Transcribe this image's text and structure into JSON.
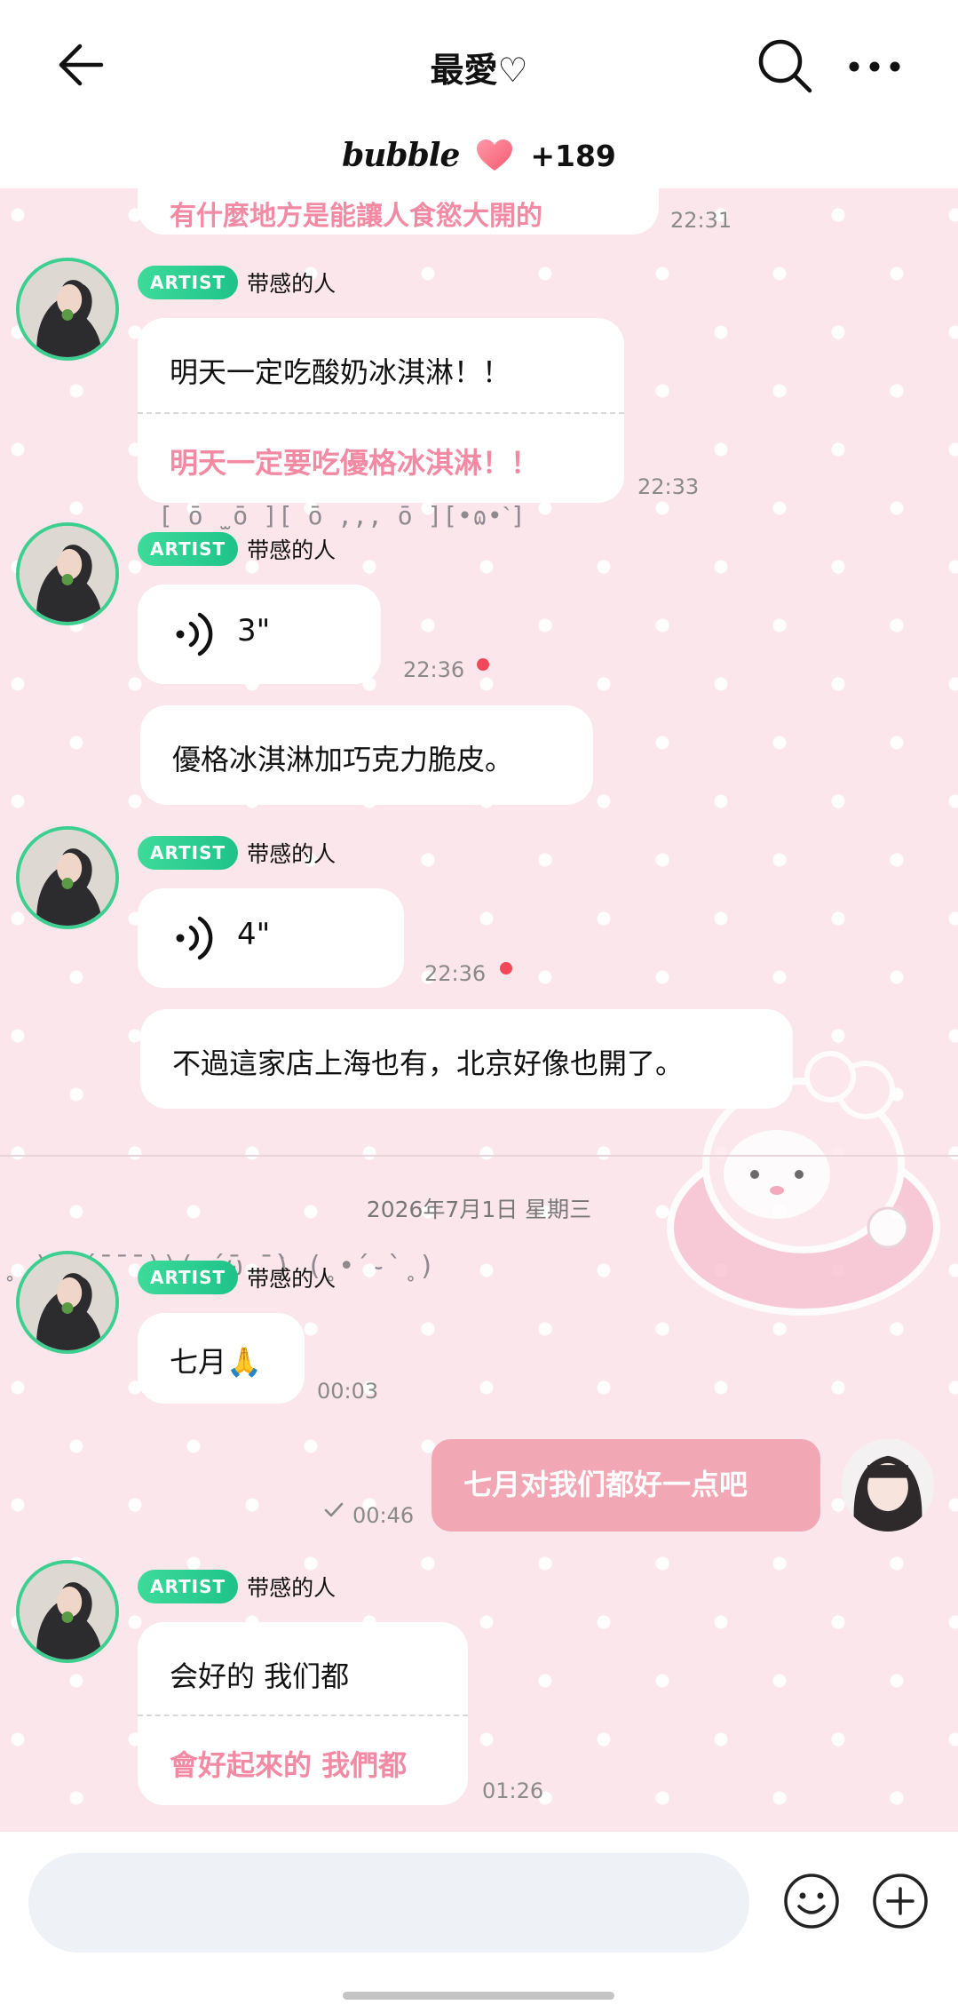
{
  "header": {
    "title": "最愛♡",
    "brand": "bubble",
    "count": "+189",
    "back_icon": "arrow-left-icon",
    "search_icon": "search-icon",
    "more_icon": "more-horizontal-icon"
  },
  "colors": {
    "chat_background": "#fbe6ec",
    "artist_badge": "#2bd392",
    "translation_text": "#f28aa4",
    "my_bubble": "#f2a8b4",
    "unread_dot": "#f04a5a"
  },
  "messages": {
    "m0": {
      "text_partial": "有什麼地方是能讓人食慾大開的",
      "time": "22:31"
    },
    "m1": {
      "badge": "ARTIST",
      "sender": "带感的人",
      "text": "明天一定吃酸奶冰淇淋！！",
      "translation": "明天一定要吃優格冰淇淋！！",
      "time": "22:33"
    },
    "kaomoji1": "[ ō ̫ ō ][ ō ,,, ō ][•ɷ•ˋ]",
    "m2": {
      "badge": "ARTIST",
      "sender": "带感的人",
      "voice_duration": "3\"",
      "time": "22:36"
    },
    "m3": {
      "text": "優格冰淇淋加巧克力脆皮。"
    },
    "m4": {
      "badge": "ARTIST",
      "sender": "带感的人",
      "voice_duration": "4\"",
      "time": "22:36"
    },
    "m5": {
      "text": "不過這家店上海也有，北京好像也開了。"
    },
    "date_separator": "2026年7月1日 星期三",
    "kaomoji2": "˳ )( ́ ̄ ̄ ̄ ))( ́ ̄ω ̄ ̀) (˳•́ ֊̀ ˳)",
    "m6": {
      "badge": "ARTIST",
      "sender": "带感的人",
      "text": "七月🙏",
      "time": "00:03"
    },
    "m7": {
      "text": "七月对我们都好一点吧",
      "time": "00:46",
      "status_icon": "check-icon"
    },
    "m8": {
      "badge": "ARTIST",
      "sender": "带感的人",
      "text": "会好的 我们都",
      "translation": "會好起來的 我們都",
      "time": "01:26"
    }
  },
  "composer": {
    "placeholder": "",
    "emoji_icon": "smiley-icon",
    "plus_icon": "plus-circle-icon"
  }
}
